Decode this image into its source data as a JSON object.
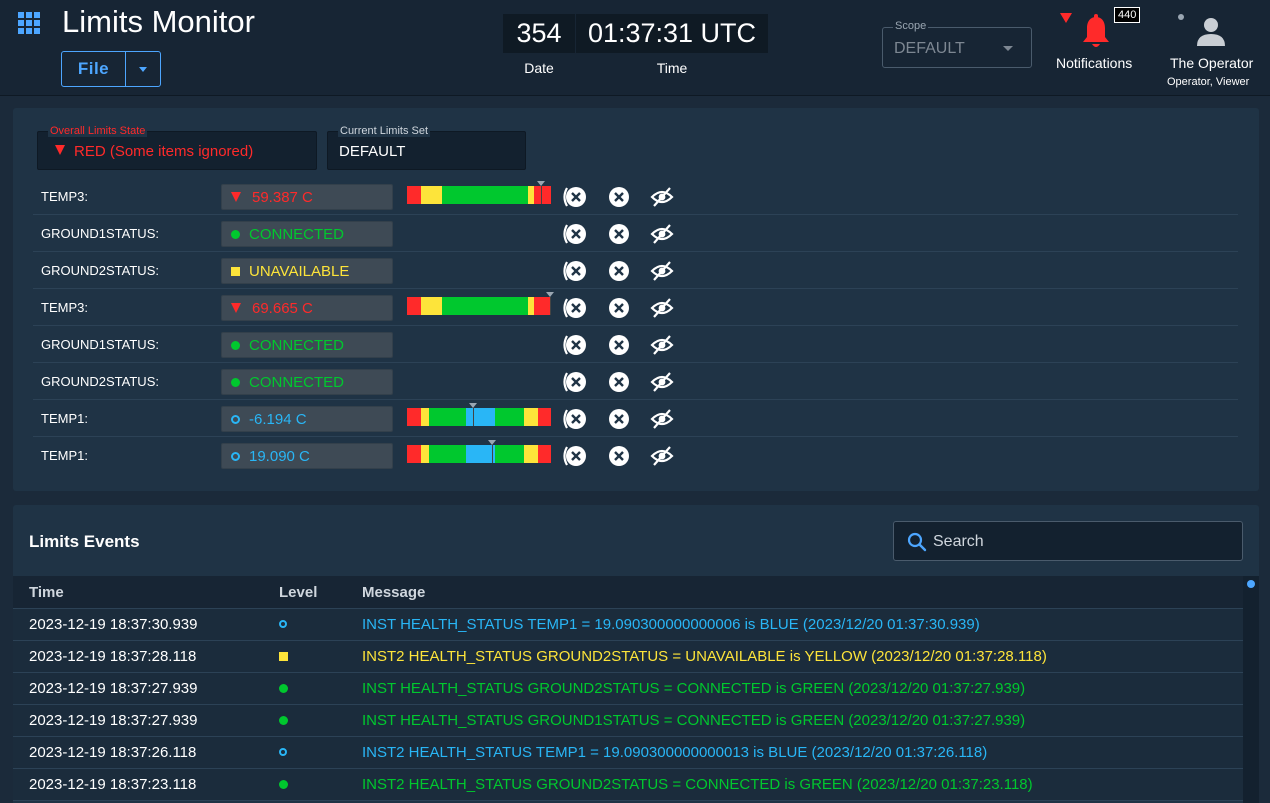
{
  "header": {
    "title": "Limits Monitor",
    "file_label": "File",
    "date_value": "354",
    "date_label": "Date",
    "time_value": "01:37:31 UTC",
    "time_label": "Time",
    "scope_label": "Scope",
    "scope_value": "DEFAULT",
    "notifications_count": "440",
    "notifications_label": "Notifications",
    "user_name": "The Operator",
    "user_role": "Operator, Viewer"
  },
  "limits": {
    "overall_label": "Overall Limits State",
    "overall_value": "RED (Some items ignored)",
    "current_set_label": "Current Limits Set",
    "current_set_value": "DEFAULT",
    "rows": [
      {
        "name": "TEMP3:",
        "value": "59.387 C",
        "state": "red",
        "bar": "narrow",
        "marker": 0.93
      },
      {
        "name": "GROUND1STATUS:",
        "value": "CONNECTED",
        "state": "green",
        "bar": null
      },
      {
        "name": "GROUND2STATUS:",
        "value": "UNAVAILABLE",
        "state": "yellow",
        "bar": null
      },
      {
        "name": "TEMP3:",
        "value": "69.665 C",
        "state": "red",
        "bar": "narrow",
        "marker": 0.99
      },
      {
        "name": "GROUND1STATUS:",
        "value": "CONNECTED",
        "state": "green",
        "bar": null
      },
      {
        "name": "GROUND2STATUS:",
        "value": "CONNECTED",
        "state": "green",
        "bar": null
      },
      {
        "name": "TEMP1:",
        "value": "-6.194 C",
        "state": "blue",
        "bar": "wide",
        "marker": 0.46
      },
      {
        "name": "TEMP1:",
        "value": "19.090 C",
        "state": "blue",
        "bar": "wide",
        "marker": 0.59
      }
    ]
  },
  "events": {
    "title": "Limits Events",
    "search_placeholder": "Search",
    "columns": [
      "Time",
      "Level",
      "Message"
    ],
    "rows": [
      {
        "time": "2023-12-19 18:37:30.939",
        "level": "blue",
        "message": "INST HEALTH_STATUS TEMP1 = 19.090300000000006 is BLUE (2023/12/20 01:37:30.939)"
      },
      {
        "time": "2023-12-19 18:37:28.118",
        "level": "yellow",
        "message": "INST2 HEALTH_STATUS GROUND2STATUS = UNAVAILABLE is YELLOW (2023/12/20 01:37:28.118)"
      },
      {
        "time": "2023-12-19 18:37:27.939",
        "level": "green",
        "message": "INST HEALTH_STATUS GROUND2STATUS = CONNECTED is GREEN (2023/12/20 01:37:27.939)"
      },
      {
        "time": "2023-12-19 18:37:27.939",
        "level": "green",
        "message": "INST HEALTH_STATUS GROUND1STATUS = CONNECTED is GREEN (2023/12/20 01:37:27.939)"
      },
      {
        "time": "2023-12-19 18:37:26.118",
        "level": "blue",
        "message": "INST2 HEALTH_STATUS TEMP1 = 19.090300000000013 is BLUE (2023/12/20 01:37:26.118)"
      },
      {
        "time": "2023-12-19 18:37:23.118",
        "level": "green",
        "message": "INST2 HEALTH_STATUS GROUND2STATUS = CONNECTED is GREEN (2023/12/20 01:37:23.118)"
      }
    ]
  },
  "colors": {
    "red": "#ff2a2a",
    "green": "#00c82e",
    "yellow": "#fde43a",
    "blue": "#29b6f6",
    "accent": "#4da6ff"
  }
}
